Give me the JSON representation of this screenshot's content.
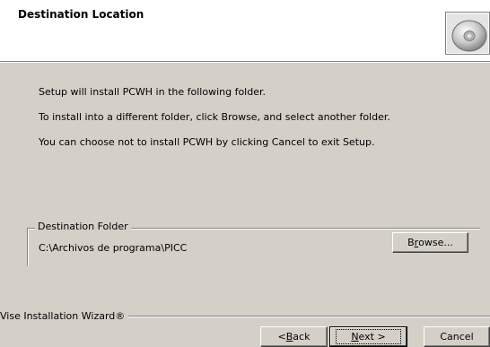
{
  "header": {
    "title": "Destination Location",
    "icon": "cd-disc-icon"
  },
  "body": {
    "line1": "Setup will install PCWH in the following folder.",
    "line2": "To install into a different folder, click Browse, and select another folder.",
    "line3": "You can choose not to install PCWH by clicking Cancel to exit Setup."
  },
  "destination": {
    "legend": "Destination Folder",
    "path": "C:\\Archivos de programa\\PICC",
    "browse_prefix": "B",
    "browse_accel": "r",
    "browse_suffix": "owse..."
  },
  "footer": {
    "brand": "Vise Installation Wizard®",
    "back_prefix": "< ",
    "back_accel": "B",
    "back_suffix": "ack",
    "next_accel": "N",
    "next_suffix": "ext >",
    "cancel_label": "Cancel"
  }
}
